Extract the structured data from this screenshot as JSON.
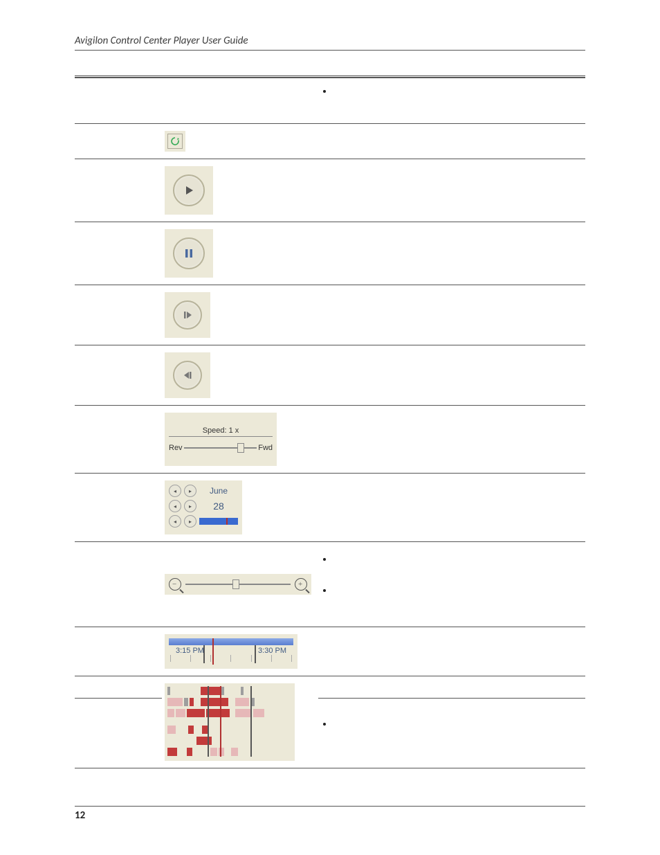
{
  "header": {
    "running_head": "Avigilon Control Center Player User Guide"
  },
  "footer": {
    "page_number": "12"
  },
  "speed": {
    "label": "Speed: 1 x",
    "left": "Rev",
    "right": "Fwd"
  },
  "calendar": {
    "month": "June",
    "day": "28"
  },
  "timeline": {
    "t1": "3:15 PM",
    "t2": "3:30 PM"
  }
}
